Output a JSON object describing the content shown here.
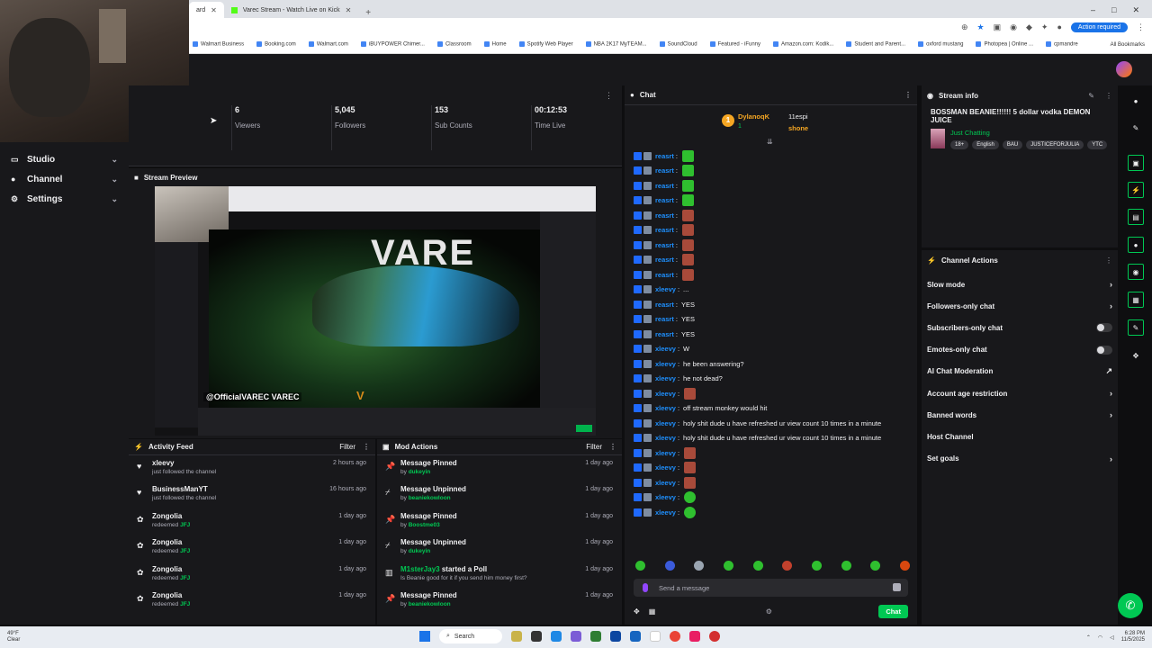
{
  "browser": {
    "tabs": [
      {
        "label": "ard",
        "active": true
      },
      {
        "label": "Varec Stream - Watch Live on Kick",
        "active": false
      }
    ],
    "action_required": "Action required",
    "bookmarks": [
      "Walmart Business",
      "Booking.com",
      "Walmart.com",
      "iBUYPOWER Chimer...",
      "Classroom",
      "Home",
      "Spotify Web Player",
      "NBA 2K17 MyTEAM...",
      "SoundCloud",
      "Featured - iFunny",
      "Amazon.com: Kodik...",
      "Student and Parent...",
      "oxford mustang",
      "Photopea | Online ...",
      "cpmandre"
    ],
    "all_bookmarks": "All Bookmarks"
  },
  "sidebar": {
    "items": [
      {
        "label": "Studio",
        "icon": "monitor-icon"
      },
      {
        "label": "Channel",
        "icon": "user-icon"
      },
      {
        "label": "Settings",
        "icon": "gear-icon"
      }
    ]
  },
  "stats": [
    {
      "value": "6",
      "label": "Viewers"
    },
    {
      "value": "5,045",
      "label": "Followers"
    },
    {
      "value": "153",
      "label": "Sub Counts"
    },
    {
      "value": "00:12:53",
      "label": "Time Live"
    }
  ],
  "preview": {
    "title": "Stream Preview",
    "overlay_name": "@OfficialVAREC  VAREC",
    "big_text": "VARE",
    "logo": "V"
  },
  "activity": {
    "title": "Activity Feed",
    "filter": "Filter",
    "items": [
      {
        "icon": "heart-icon",
        "name": "xleevy",
        "sub": "just followed the channel",
        "sub_highlight": "",
        "time": "2 hours ago"
      },
      {
        "icon": "heart-icon",
        "name": "BusinessManYT",
        "sub": "just followed the channel",
        "sub_highlight": "",
        "time": "16 hours ago"
      },
      {
        "icon": "redeem-icon",
        "name": "Zongolia",
        "sub": "redeemed",
        "sub_highlight": "JFJ",
        "time": "1 day ago"
      },
      {
        "icon": "redeem-icon",
        "name": "Zongolia",
        "sub": "redeemed",
        "sub_highlight": "JFJ",
        "time": "1 day ago"
      },
      {
        "icon": "redeem-icon",
        "name": "Zongolia",
        "sub": "redeemed",
        "sub_highlight": "JFJ",
        "time": "1 day ago"
      },
      {
        "icon": "redeem-icon",
        "name": "Zongolia",
        "sub": "redeemed",
        "sub_highlight": "JFJ",
        "time": "1 day ago"
      }
    ]
  },
  "mod": {
    "title": "Mod Actions",
    "filter": "Filter",
    "items": [
      {
        "icon": "pin-icon",
        "name": "Message Pinned",
        "name_highlight": "",
        "sub": "by",
        "sub_highlight": "dukeyin",
        "time": "1 day ago"
      },
      {
        "icon": "unpin-icon",
        "name": "Message Unpinned",
        "name_highlight": "",
        "sub": "by",
        "sub_highlight": "beaniekowloon",
        "time": "1 day ago"
      },
      {
        "icon": "pin-icon",
        "name": "Message Pinned",
        "name_highlight": "",
        "sub": "by",
        "sub_highlight": "Boostme03",
        "time": "1 day ago"
      },
      {
        "icon": "unpin-icon",
        "name": "Message Unpinned",
        "name_highlight": "",
        "sub": "by",
        "sub_highlight": "dukeyin",
        "time": "1 day ago"
      },
      {
        "icon": "poll-icon",
        "name": "started a Poll",
        "name_highlight": "M1sterJay3",
        "sub": "Is Beanie good for it if you send him money first?",
        "sub_highlight": "",
        "time": "1 day ago"
      },
      {
        "icon": "pin-icon",
        "name": "Message Pinned",
        "name_highlight": "",
        "sub": "by",
        "sub_highlight": "beaniekowloon",
        "time": "1 day ago"
      }
    ]
  },
  "chat": {
    "title": "Chat",
    "pinned": {
      "coin": "1",
      "user1": "DylanoqK",
      "user1_count": "1",
      "user2": "11espi",
      "user2_count": "1",
      "user3": "shone",
      "user3_count": "1"
    },
    "messages": [
      {
        "user": "reasrt",
        "text": "",
        "emote": "green"
      },
      {
        "user": "reasrt",
        "text": "",
        "emote": "green"
      },
      {
        "user": "reasrt",
        "text": "",
        "emote": "green"
      },
      {
        "user": "reasrt",
        "text": "",
        "emote": "green"
      },
      {
        "user": "reasrt",
        "text": "",
        "emote": "red"
      },
      {
        "user": "reasrt",
        "text": "",
        "emote": "red"
      },
      {
        "user": "reasrt",
        "text": "",
        "emote": "red"
      },
      {
        "user": "reasrt",
        "text": "",
        "emote": "red"
      },
      {
        "user": "reasrt",
        "text": "",
        "emote": "red"
      },
      {
        "user": "xleevy",
        "text": "...",
        "emote": ""
      },
      {
        "user": "reasrt",
        "text": "YES",
        "emote": ""
      },
      {
        "user": "reasrt",
        "text": "YES",
        "emote": ""
      },
      {
        "user": "reasrt",
        "text": "YES",
        "emote": ""
      },
      {
        "user": "xleevy",
        "text": "W",
        "emote": ""
      },
      {
        "user": "xleevy",
        "text": "he been answering?",
        "emote": ""
      },
      {
        "user": "xleevy",
        "text": "he not dead?",
        "emote": ""
      },
      {
        "user": "xleevy",
        "text": "",
        "emote": "red"
      },
      {
        "user": "xleevy",
        "text": "off stream monkey would hit",
        "emote": ""
      },
      {
        "user": "xleevy",
        "text": "holy shit dude u have refreshed ur view count 10 times in a minute",
        "emote": ""
      },
      {
        "user": "xleevy",
        "text": "holy shit dude u have refreshed ur view count 10 times in a minute",
        "emote": ""
      },
      {
        "user": "xleevy",
        "text": "",
        "emote": "red"
      },
      {
        "user": "xleevy",
        "text": "",
        "emote": "red"
      },
      {
        "user": "xleevy",
        "text": "",
        "emote": "red"
      },
      {
        "user": "xleevy",
        "text": "",
        "emote": "face"
      },
      {
        "user": "xleevy",
        "text": "",
        "emote": "face"
      }
    ],
    "input_placeholder": "Send a message",
    "send_label": "Chat"
  },
  "stream_info": {
    "title": "Stream info",
    "stream_title": "BOSSMAN BEANIE!!!!!! 5 dollar vodka DEMON JUICE",
    "category": "Just Chatting",
    "tags": [
      "18+",
      "English",
      "BAU",
      "JUSTICEFORJULIA",
      "YTC"
    ]
  },
  "channel_actions": {
    "title": "Channel Actions",
    "items": [
      {
        "label": "Slow mode",
        "control": "arrow"
      },
      {
        "label": "Followers-only chat",
        "control": "arrow"
      },
      {
        "label": "Subscribers-only chat",
        "control": "toggle"
      },
      {
        "label": "Emotes-only chat",
        "control": "toggle"
      },
      {
        "label": "AI Chat Moderation",
        "control": "link"
      },
      {
        "label": "Account age restriction",
        "control": "arrow"
      },
      {
        "label": "Banned words",
        "control": "arrow"
      },
      {
        "label": "Host Channel",
        "control": "none"
      },
      {
        "label": "Set goals",
        "control": "arrow"
      }
    ]
  },
  "taskbar": {
    "weather_temp": "49°F",
    "weather_desc": "Clear",
    "search": "Search",
    "time": "6:28 PM",
    "date": "11/5/2025"
  },
  "colors": {
    "accent": "#00c853",
    "background": "#0e0e10",
    "panel": "#18181b"
  }
}
